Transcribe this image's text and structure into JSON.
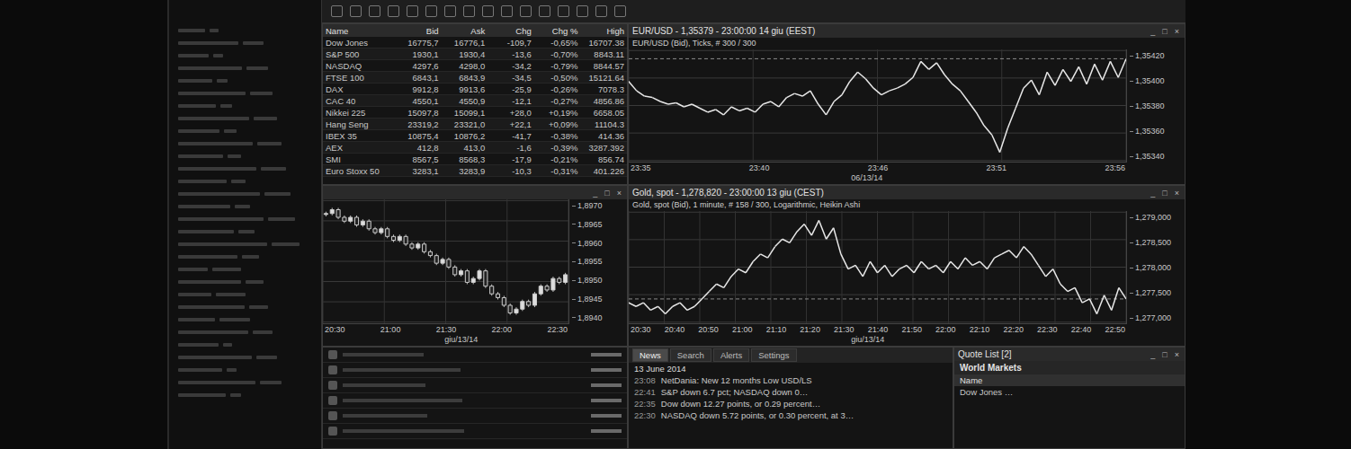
{
  "window_buttons": [
    "_",
    "□",
    "×"
  ],
  "table": {
    "columns": [
      "Name",
      "Bid",
      "Ask",
      "Chg",
      "Chg %",
      "High"
    ],
    "rows": [
      [
        "Dow Jones",
        "16775,7",
        "16776,1",
        "-109,7",
        "-0,65%",
        "16707.38"
      ],
      [
        "S&P 500",
        "1930,1",
        "1930,4",
        "-13,6",
        "-0,70%",
        "8843.11"
      ],
      [
        "NASDAQ",
        "4297,6",
        "4298,0",
        "-34,2",
        "-0,79%",
        "8844.57"
      ],
      [
        "FTSE 100",
        "6843,1",
        "6843,9",
        "-34,5",
        "-0,50%",
        "15121.64"
      ],
      [
        "DAX",
        "9912,8",
        "9913,6",
        "-25,9",
        "-0,26%",
        "7078.3"
      ],
      [
        "CAC 40",
        "4550,1",
        "4550,9",
        "-12,1",
        "-0,27%",
        "4856.86"
      ],
      [
        "Nikkei 225",
        "15097,8",
        "15099,1",
        "+28,0",
        "+0,19%",
        "6658.05"
      ],
      [
        "Hang Seng",
        "23319,2",
        "23321,0",
        "+22,1",
        "+0,09%",
        "11104.3"
      ],
      [
        "IBEX 35",
        "10875,4",
        "10876,2",
        "-41,7",
        "-0,38%",
        "414.36"
      ],
      [
        "AEX",
        "412,8",
        "413,0",
        "-1,6",
        "-0,39%",
        "3287.392"
      ],
      [
        "SMI",
        "8567,5",
        "8568,3",
        "-17,9",
        "-0,21%",
        "856.74"
      ],
      [
        "Euro Stoxx 50",
        "3283,1",
        "3283,9",
        "-10,3",
        "-0,31%",
        "401.226"
      ]
    ]
  },
  "charts": {
    "eurusd": {
      "title": "EUR/USD - 1,35379 - 23:00:00 14 giu (EEST)",
      "subtitle": "EUR/USD (Bid), Ticks, # 300 / 300",
      "x_ticks": [
        "23:35",
        "23:40",
        "23:46",
        "23:51",
        "23:56"
      ],
      "date": "06/13/14",
      "y_ticks": [
        "1,35420",
        "1,35400",
        "1,35380",
        "1,35360",
        "1,35340"
      ],
      "values": [
        1.35395,
        1.35388,
        1.35384,
        1.35383,
        1.3538,
        1.35378,
        1.35379,
        1.35376,
        1.35378,
        1.35375,
        1.35372,
        1.35374,
        1.3537,
        1.35376,
        1.35373,
        1.35375,
        1.35372,
        1.35378,
        1.3538,
        1.35376,
        1.35383,
        1.35386,
        1.35384,
        1.35388,
        1.35378,
        1.3537,
        1.3538,
        1.35385,
        1.35395,
        1.35402,
        1.35397,
        1.3539,
        1.35385,
        1.35388,
        1.3539,
        1.35393,
        1.35398,
        1.3541,
        1.35404,
        1.35409,
        1.354,
        1.35393,
        1.35388,
        1.3538,
        1.35372,
        1.35362,
        1.35355,
        1.35342,
        1.3536,
        1.35375,
        1.3539,
        1.35396,
        1.35385,
        1.35402,
        1.35392,
        1.35404,
        1.35395,
        1.35406,
        1.35393,
        1.35408,
        1.35396,
        1.3541,
        1.35398,
        1.35412
      ]
    },
    "candles": {
      "title": "",
      "subtitle": "",
      "x_ticks": [
        "20:30",
        "21:00",
        "21:30",
        "22:00",
        "22:30"
      ],
      "date": "giu/13/14",
      "y_ticks": [
        "1,8970",
        "1,8965",
        "1,8960",
        "1,8955",
        "1,8950",
        "1,8945",
        "1,8940"
      ],
      "values": [
        1.8968,
        1.8969,
        1.8967,
        1.8966,
        1.8967,
        1.8965,
        1.8966,
        1.8964,
        1.8963,
        1.8964,
        1.8962,
        1.8961,
        1.8962,
        1.896,
        1.8959,
        1.896,
        1.8958,
        1.8957,
        1.8955,
        1.8956,
        1.8954,
        1.8952,
        1.8953,
        1.895,
        1.8951,
        1.8953,
        1.8949,
        1.8947,
        1.8946,
        1.8944,
        1.8942,
        1.8943,
        1.8945,
        1.8944,
        1.8947,
        1.8949,
        1.8948,
        1.8951,
        1.895,
        1.8952
      ]
    },
    "gold": {
      "title": "Gold, spot - 1,278,820 - 23:00:00 13 giu (CEST)",
      "subtitle": "Gold, spot (Bid), 1 minute, # 158 / 300, Logarithmic, Heikin Ashi",
      "x_ticks": [
        "20:30",
        "20:40",
        "20:50",
        "21:00",
        "21:10",
        "21:20",
        "21:30",
        "21:40",
        "21:50",
        "22:00",
        "22:10",
        "22:20",
        "22:30",
        "22:40",
        "22:50"
      ],
      "date": "giu/13/14",
      "y_ticks": [
        "1,279,000",
        "1,278,500",
        "1,278,000",
        "1,277,500",
        "1,277,000"
      ],
      "values": [
        1276.9,
        1276.8,
        1276.9,
        1276.7,
        1276.8,
        1276.6,
        1276.8,
        1276.9,
        1276.7,
        1276.8,
        1277.0,
        1277.2,
        1277.4,
        1277.3,
        1277.6,
        1277.8,
        1277.7,
        1278.0,
        1278.2,
        1278.1,
        1278.4,
        1278.6,
        1278.5,
        1278.8,
        1279.0,
        1278.7,
        1279.1,
        1278.6,
        1278.9,
        1278.2,
        1277.8,
        1277.9,
        1277.6,
        1278.0,
        1277.7,
        1277.9,
        1277.6,
        1277.8,
        1277.9,
        1277.7,
        1278.0,
        1277.8,
        1277.9,
        1277.7,
        1278.0,
        1277.8,
        1278.1,
        1277.9,
        1278.0,
        1277.8,
        1278.1,
        1278.2,
        1278.3,
        1278.1,
        1278.4,
        1278.2,
        1277.9,
        1277.6,
        1277.8,
        1277.4,
        1277.2,
        1277.3,
        1276.9,
        1277.0,
        1276.6,
        1277.1,
        1276.7,
        1277.3,
        1277.0
      ]
    }
  },
  "news": {
    "tabs": [
      {
        "label": "News",
        "selected": true
      },
      {
        "label": "Search",
        "selected": false
      },
      {
        "label": "Alerts",
        "selected": false
      },
      {
        "label": "Settings",
        "selected": false
      }
    ],
    "date": "13 June 2014",
    "items": [
      {
        "time": "23:08",
        "text": "NetDania: New 12 months Low USD/LS"
      },
      {
        "time": "22:41",
        "text": "S&P down 6.7 pct; NASDAQ down 0…"
      },
      {
        "time": "22:35",
        "text": "Dow down 12.27 points, or 0.29 percent…"
      },
      {
        "time": "22:30",
        "text": "NASDAQ down 5.72 points, or 0.30 percent, at 3…"
      }
    ]
  },
  "quote_list": {
    "title": "Quote List [2]",
    "tab": "World Markets",
    "column": "Name",
    "rows": [
      "Dow Jones …"
    ]
  }
}
